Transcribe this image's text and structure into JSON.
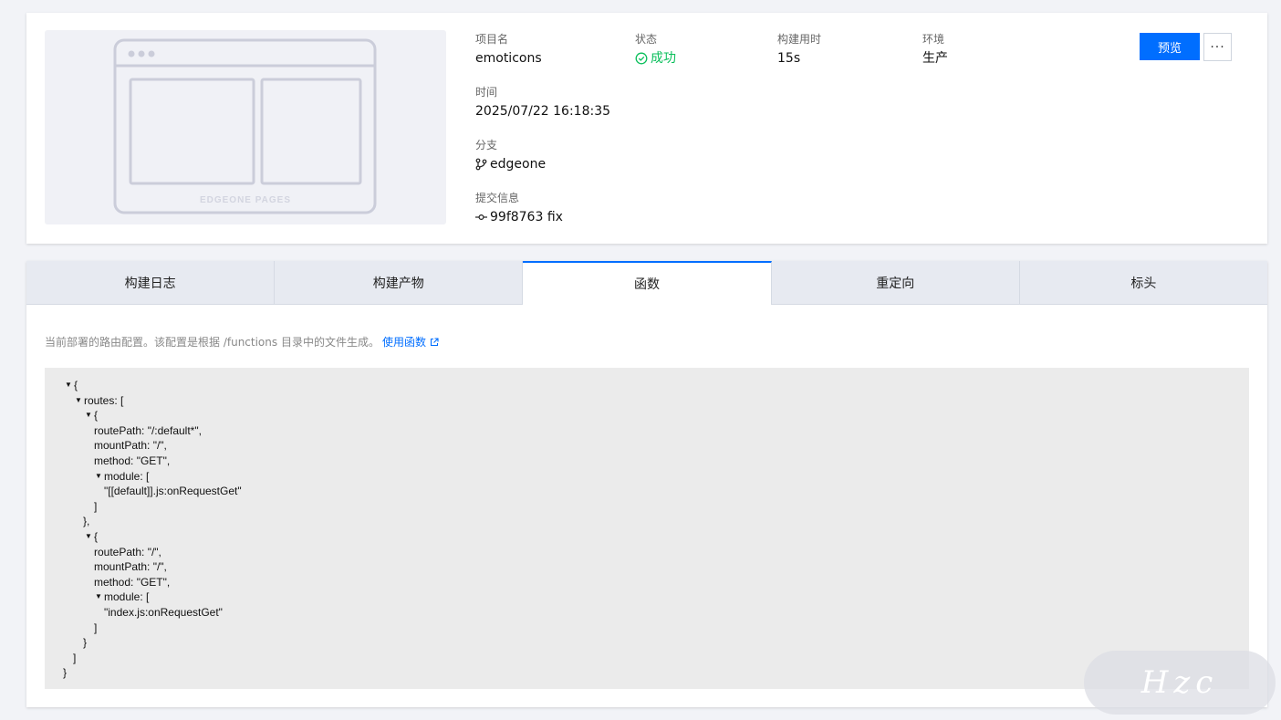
{
  "deployment": {
    "thumbnail_caption": "EDGEONE PAGES",
    "fields": {
      "project_label": "项目名",
      "project_value": "emoticons",
      "status_label": "状态",
      "status_value": "成功",
      "build_time_label": "构建用时",
      "build_time_value": "15s",
      "env_label": "环境",
      "env_value": "生产",
      "time_label": "时间",
      "time_value": "2025/07/22 16:18:35",
      "branch_label": "分支",
      "branch_value": "edgeone",
      "commit_label": "提交信息",
      "commit_value": "99f8763 fix"
    },
    "preview_button": "预览",
    "more_button": "···"
  },
  "tabs": [
    {
      "label": "构建日志",
      "active": false
    },
    {
      "label": "构建产物",
      "active": false
    },
    {
      "label": "函数",
      "active": true
    },
    {
      "label": "重定向",
      "active": false
    },
    {
      "label": "标头",
      "active": false
    }
  ],
  "functions": {
    "description": "当前部署的路由配置。该配置是根据 /functions 目录中的文件生成。",
    "link_label": "使用函数",
    "json_lines": [
      "{",
      "routes: [",
      "{",
      "routePath: \"/:default*\",",
      "mountPath: \"/\",",
      "method: \"GET\",",
      "module: [",
      "\"[[default]].js:onRequestGet\"",
      "]",
      "},",
      "{",
      "routePath: \"/\",",
      "mountPath: \"/\",",
      "method: \"GET\",",
      "module: [",
      "\"index.js:onRequestGet\"",
      "]",
      "}",
      "]",
      "}"
    ]
  },
  "watermark": "Hzc",
  "colors": {
    "accent": "#006eff",
    "success": "#0abf5b"
  },
  "icons": [
    "success-icon",
    "branch-icon",
    "commit-icon",
    "external-link-icon",
    "collapse-triangle-icon",
    "more-icon"
  ]
}
